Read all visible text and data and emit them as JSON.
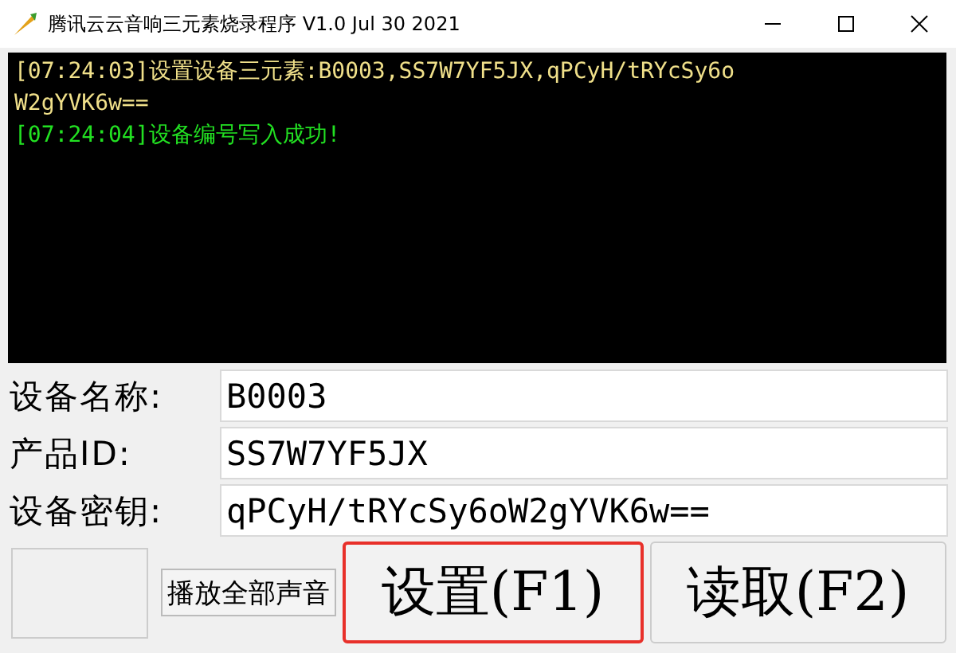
{
  "window": {
    "title": "腾讯云云音响三元素烧录程序 V1.0 Jul 30 2021"
  },
  "log": [
    {
      "text": "[07:24:03]设置设备三元素:B0003,SS7W7YF5JX,qPCyH/tRYcSy6oW2gYVK6w==",
      "kind": "info"
    },
    {
      "text": "[07:24:04]设备编号写入成功!",
      "kind": "success"
    }
  ],
  "fields": [
    {
      "label": "设备名称:",
      "value": "B0003"
    },
    {
      "label": "产品ID:",
      "value": "SS7W7YF5JX"
    },
    {
      "label": "设备密钥:",
      "value": "qPCyH/tRYcSy6oW2gYVK6w=="
    }
  ],
  "play_button": {
    "label": "播放全部声音"
  },
  "actions": [
    {
      "label": "设置(F1)",
      "focused": true
    },
    {
      "label": "读取(F2)",
      "focused": false
    }
  ]
}
